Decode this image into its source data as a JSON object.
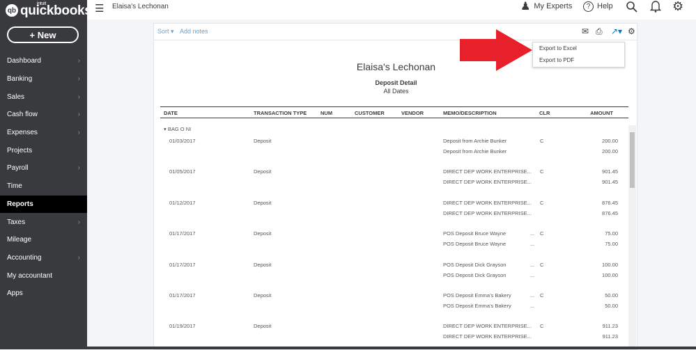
{
  "brand": {
    "intuit": "intuit",
    "name": "quickbooks"
  },
  "new_button": "+ New",
  "nav": [
    {
      "label": "Dashboard",
      "chevron": true
    },
    {
      "label": "Banking",
      "chevron": true
    },
    {
      "label": "Sales",
      "chevron": true
    },
    {
      "label": "Cash flow",
      "chevron": true
    },
    {
      "label": "Expenses",
      "chevron": true
    },
    {
      "label": "Projects",
      "chevron": false
    },
    {
      "label": "Payroll",
      "chevron": true
    },
    {
      "label": "Time",
      "chevron": false
    },
    {
      "label": "Reports",
      "chevron": false,
      "active": true
    },
    {
      "label": "Taxes",
      "chevron": true
    },
    {
      "label": "Mileage",
      "chevron": false
    },
    {
      "label": "Accounting",
      "chevron": true
    },
    {
      "label": "My accountant",
      "chevron": false
    },
    {
      "label": "Apps",
      "chevron": false
    }
  ],
  "header": {
    "company": "Elaisa's Lechonan",
    "my_experts": "My Experts",
    "help": "Help"
  },
  "report_toolbar": {
    "sort": "Sort",
    "add_notes": "Add notes"
  },
  "export_menu": {
    "excel": "Export to Excel",
    "pdf": "Export to PDF"
  },
  "report": {
    "company": "Elaisa's Lechonan",
    "title": "Deposit Detail",
    "subtitle": "All Dates"
  },
  "columns": [
    "DATE",
    "TRANSACTION TYPE",
    "NUM",
    "CUSTOMER",
    "VENDOR",
    "MEMO/DESCRIPTION",
    "CLR",
    "AMOUNT"
  ],
  "group": "BAG O NI",
  "rows": [
    {
      "date": "01/03/2017",
      "type": "Deposit",
      "memo": "Deposit from Archie Bunker",
      "memo2": "Deposit from Archie Bunker",
      "dots": "",
      "clr": "C",
      "amount": "200.00",
      "amount2": "200.00"
    },
    {
      "date": "01/05/2017",
      "type": "Deposit",
      "memo": "DIRECT DEP WORK ENTERPRISE...",
      "memo2": "DIRECT DEP WORK ENTERPRISE...",
      "dots": "",
      "clr": "C",
      "amount": "901.45",
      "amount2": "901.45"
    },
    {
      "date": "01/12/2017",
      "type": "Deposit",
      "memo": "DIRECT DEP WORK ENTERPRISE...",
      "memo2": "DIRECT DEP WORK ENTERPRISE...",
      "dots": "",
      "clr": "C",
      "amount": "876.45",
      "amount2": "876.45"
    },
    {
      "date": "01/17/2017",
      "type": "Deposit",
      "memo": "POS Deposit Bruce Wayne",
      "memo2": "POS Deposit Bruce Wayne",
      "dots": "...",
      "clr": "C",
      "amount": "75.00",
      "amount2": "75.00"
    },
    {
      "date": "01/17/2017",
      "type": "Deposit",
      "memo": "POS Deposit Dick Grayson",
      "memo2": "POS Deposit Dick Grayson",
      "dots": "...",
      "clr": "C",
      "amount": "100.00",
      "amount2": "100.00"
    },
    {
      "date": "01/17/2017",
      "type": "Deposit",
      "memo": "POS Deposit Emma's Bakery",
      "memo2": "POS Deposit Emma's Bakery",
      "dots": "...",
      "clr": "C",
      "amount": "50.00",
      "amount2": "50.00"
    },
    {
      "date": "01/19/2017",
      "type": "Deposit",
      "memo": "DIRECT DEP WORK ENTERPRISE...",
      "memo2": "DIRECT DEP WORK ENTERPRISE...",
      "dots": "",
      "clr": "C",
      "amount": "911.23",
      "amount2": "911.23"
    }
  ],
  "colors": {
    "sidebar": "#393a3d",
    "accent": "#0077c5",
    "arrow": "#e8202a"
  }
}
